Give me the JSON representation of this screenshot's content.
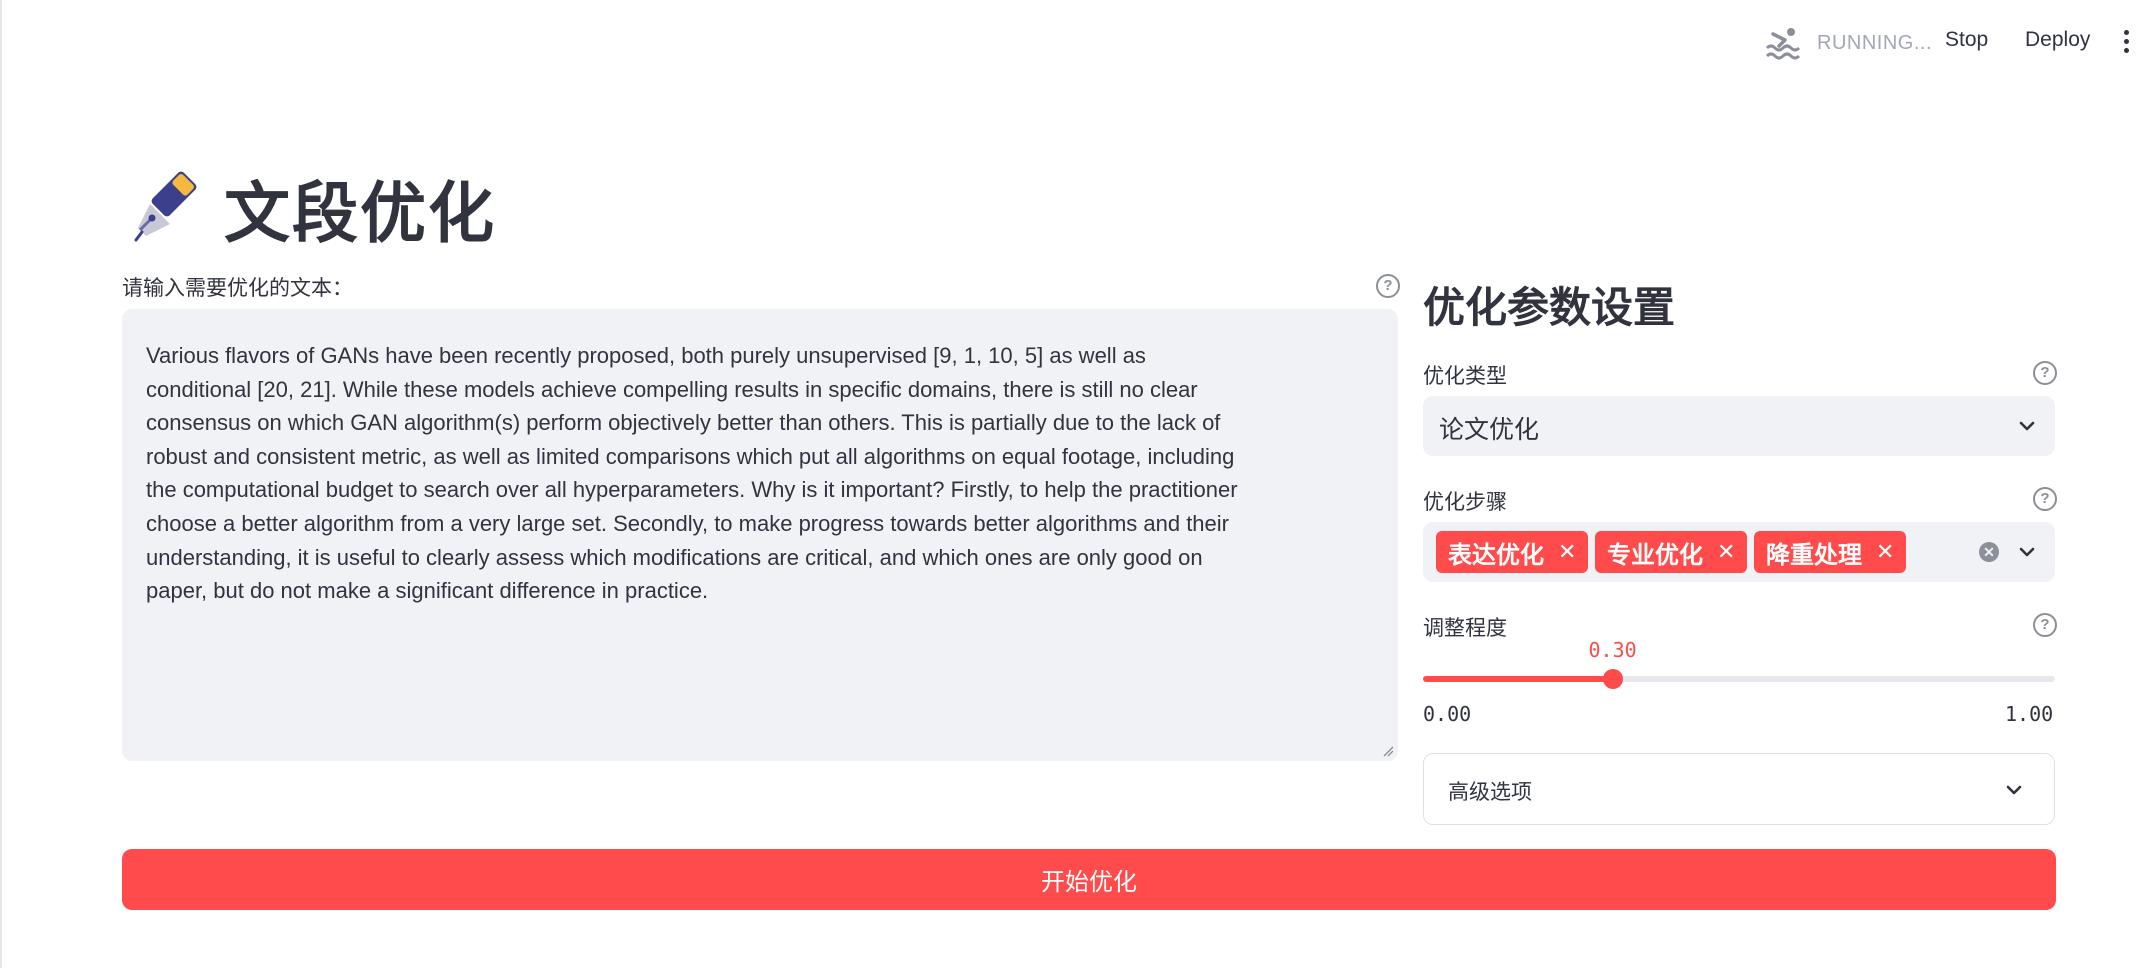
{
  "header": {
    "status_text": "RUNNING...",
    "stop_label": "Stop",
    "deploy_label": "Deploy"
  },
  "page": {
    "title": "文段优化",
    "title_icon": "fountain-pen-icon"
  },
  "input": {
    "label": "请输入需要优化的文本：",
    "value": "Various flavors of GANs have been recently proposed, both purely unsupervised [9, 1, 10, 5] as well as conditional [20, 21]. While these models achieve compelling results in specific domains, there is still no clear consensus on which GAN algorithm(s) perform objectively better than others. This is partially due to the lack of robust and consistent metric, as well as limited comparisons which put all algorithms on equal footage, including the computational budget to search over all hyperparameters. Why is it important? Firstly, to help the practitioner choose a better algorithm from a very large set. Secondly, to make progress towards better algorithms and their understanding, it is useful to clearly assess which modifications are critical, and which ones are only good on paper, but do not make a significant difference in practice."
  },
  "settings": {
    "title": "优化参数设置",
    "type_label": "优化类型",
    "type_value": "论文优化",
    "steps_label": "优化步骤",
    "steps": [
      "表达优化",
      "专业优化",
      "降重处理"
    ],
    "degree_label": "调整程度",
    "degree_value": "0.30",
    "degree_fraction": 0.3,
    "degree_min": "0.00",
    "degree_max": "1.00",
    "advanced_label": "高级选项"
  },
  "actions": {
    "start_label": "开始优化"
  },
  "colors": {
    "accent": "#ff4b4b",
    "field_bg": "#f0f2f6",
    "text": "#31333f"
  }
}
